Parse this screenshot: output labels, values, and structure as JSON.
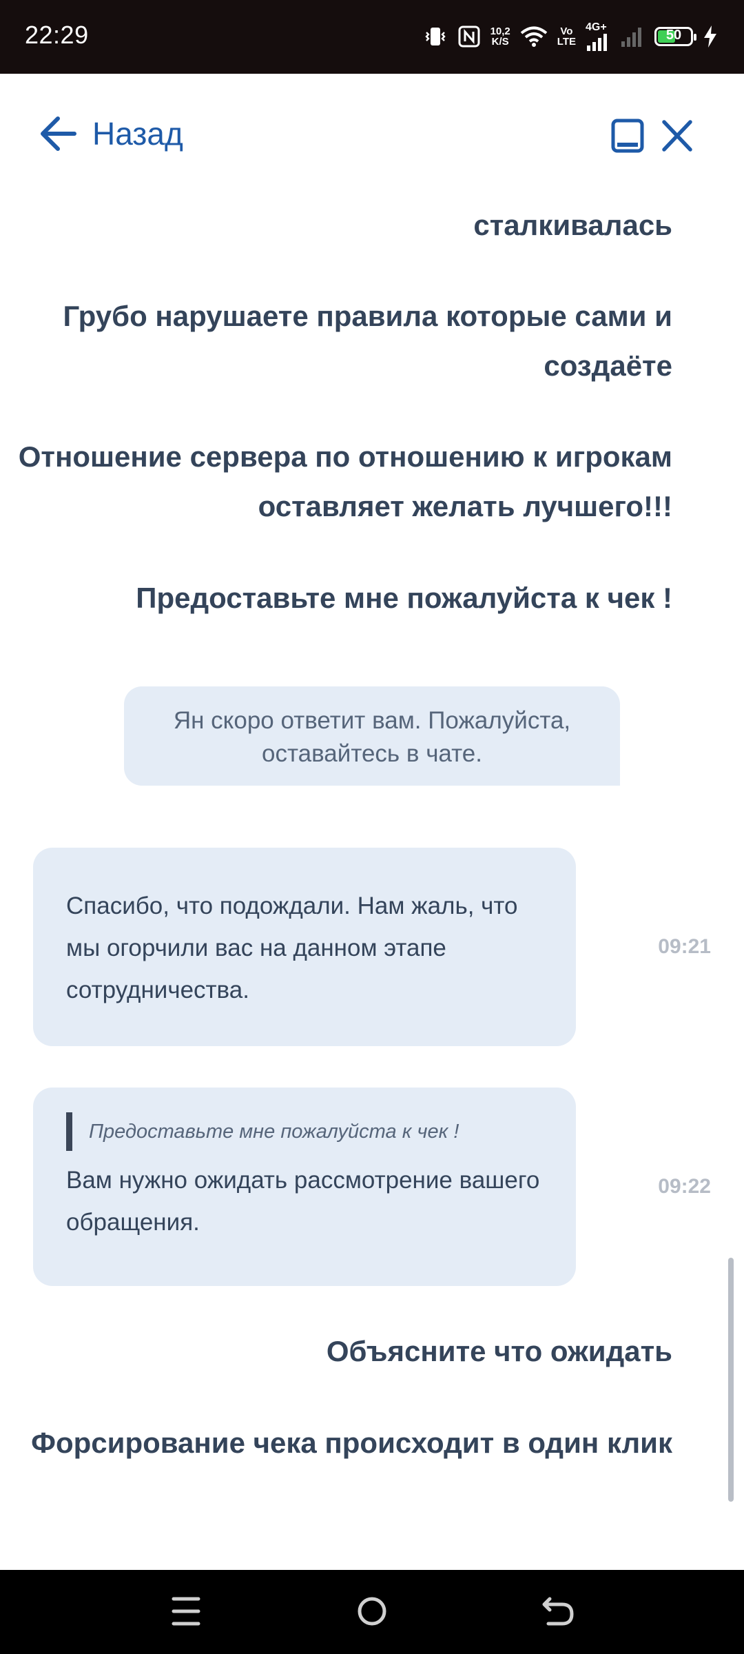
{
  "status_bar": {
    "time": "22:29",
    "net_speed_value": "10,2",
    "net_speed_unit": "K/S",
    "volte_top": "Vo",
    "volte_bottom": "LTE",
    "network_type": "4G+",
    "battery_level": "50",
    "icons": [
      "vibrate-icon",
      "nfc-icon",
      "wifi-icon",
      "signal-icon",
      "signal-empty-icon",
      "battery-icon",
      "charging-icon"
    ]
  },
  "header": {
    "back_label": "Назад",
    "icons": [
      "back-arrow-icon",
      "minimize-icon",
      "close-icon"
    ],
    "accent": "#1e5aa8"
  },
  "chat": {
    "user_messages_top": [
      "сталкивалась",
      "Грубо нарушаете правила которые сами и создаёте",
      "Отношение сервера по отношению к игрокам оставляет желать лучшего!!!",
      "Предоставьте мне пожалуйста к чек !"
    ],
    "system_note": "Ян скоро ответит вам. Пожалуйста, оставайтесь в чате.",
    "agent_messages": [
      {
        "text": "Спасибо, что подождали. Нам жаль, что мы огорчили вас на данном этапе сотрудничества.",
        "time": "09:21"
      },
      {
        "quote": "Предоставьте мне пожалуйста к чек !",
        "text": "Вам нужно ожидать рассмотрение вашего обращения.",
        "time": "09:22"
      }
    ],
    "user_messages_bottom": [
      "Объясните что ожидать",
      "Форсирование чека происходит в один клик"
    ],
    "bubble_color": "#e4ecf6"
  },
  "nav_bar": {
    "icons": [
      "menu-icon",
      "home-icon",
      "back-icon"
    ]
  }
}
